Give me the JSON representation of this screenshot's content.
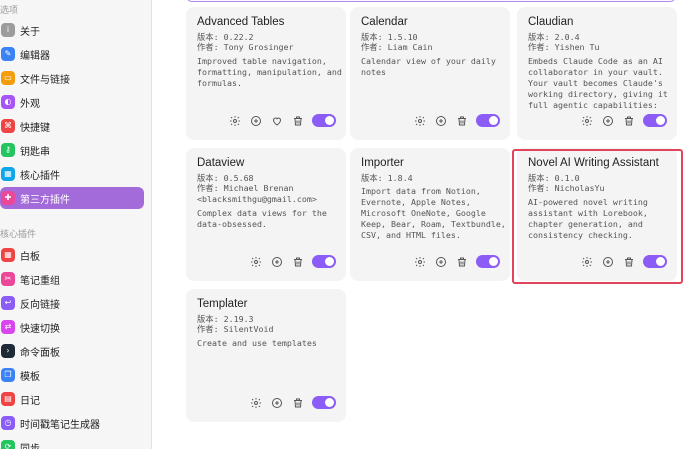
{
  "sidebar": {
    "section_options": "选项",
    "section_core_plugins": "核心插件",
    "items": [
      {
        "label": "关于",
        "icon": "info-icon",
        "color": "#9c9c9c",
        "glyph": "i"
      },
      {
        "label": "编辑器",
        "icon": "pencil-icon",
        "color": "#3b82f6",
        "glyph": "✎"
      },
      {
        "label": "文件与链接",
        "icon": "folder-icon",
        "color": "#f59e0b",
        "glyph": "▭"
      },
      {
        "label": "外观",
        "icon": "palette-icon",
        "color": "#a855f7",
        "glyph": "◐"
      },
      {
        "label": "快捷键",
        "icon": "command-icon",
        "color": "#ef4444",
        "glyph": "⌘"
      },
      {
        "label": "钥匙串",
        "icon": "key-icon",
        "color": "#22c55e",
        "glyph": "⚷"
      },
      {
        "label": "核心插件",
        "icon": "plug-icon",
        "color": "#0ea5e9",
        "glyph": "▦"
      },
      {
        "label": "第三方插件",
        "icon": "puzzle-icon",
        "color": "#ec4899",
        "glyph": "✚"
      }
    ],
    "core_items": [
      {
        "label": "白板",
        "icon": "canvas-icon",
        "color": "#ef4444",
        "glyph": "▦"
      },
      {
        "label": "笔记重组",
        "icon": "note-refactor-icon",
        "color": "#ec4899",
        "glyph": "✂"
      },
      {
        "label": "反向链接",
        "icon": "backlink-icon",
        "color": "#8b5cf6",
        "glyph": "↩"
      },
      {
        "label": "快速切换",
        "icon": "switcher-icon",
        "color": "#d946ef",
        "glyph": "⇄"
      },
      {
        "label": "命令面板",
        "icon": "terminal-icon",
        "color": "#1f2937",
        "glyph": "›"
      },
      {
        "label": "模板",
        "icon": "template-icon",
        "color": "#3b82f6",
        "glyph": "❐"
      },
      {
        "label": "日记",
        "icon": "calendar-icon",
        "color": "#ef4444",
        "glyph": "▤"
      },
      {
        "label": "时间戳笔记生成器",
        "icon": "clock-icon",
        "color": "#8b5cf6",
        "glyph": "◷"
      },
      {
        "label": "同步",
        "icon": "sync-icon",
        "color": "#22c55e",
        "glyph": "⟳"
      }
    ]
  },
  "plugins": [
    {
      "name": "Advanced Tables",
      "version": "版本: 0.22.2",
      "author": "作者: Tony Grosinger",
      "description": "Improved table navigation, formatting, manipulation, and formulas.",
      "has_heart": true
    },
    {
      "name": "Calendar",
      "version": "版本: 1.5.10",
      "author": "作者: Liam Cain",
      "description": "Calendar view of your daily notes",
      "has_heart": false
    },
    {
      "name": "Claudian",
      "version": "版本: 2.0.4",
      "author": "作者: Yishen Tu",
      "description": "Embeds Claude Code as an AI collaborator in your vault. Your vault becomes Claude's working directory, giving it full agentic capabilities: file read/write, search, bash commands...",
      "has_heart": false
    },
    {
      "name": "Dataview",
      "version": "版本: 0.5.68",
      "author": "作者: Michael Brenan <blacksmithgu@gmail.com>",
      "description": "Complex data views for the data-obsessed.",
      "has_heart": false
    },
    {
      "name": "Importer",
      "version": "版本: 1.8.4",
      "author": "",
      "description": "Import data from Notion, Evernote, Apple Notes, Microsoft OneNote, Google Keep, Bear, Roam, Textbundle, CSV, and HTML files.",
      "has_heart": false
    },
    {
      "name": "Novel AI Writing Assistant",
      "version": "版本: 0.1.0",
      "author": "作者: NicholasYu",
      "description": "AI-powered novel writing assistant with Lorebook, chapter generation, and consistency checking.",
      "has_heart": false
    },
    {
      "name": "Templater",
      "version": "版本: 2.19.3",
      "author": "作者: SilentVoid",
      "description": "Create and use templates",
      "has_heart": false
    }
  ],
  "colors": {
    "accent": "#a36bd9",
    "toggle": "#8b5cf6",
    "highlight": "#e0455c"
  }
}
